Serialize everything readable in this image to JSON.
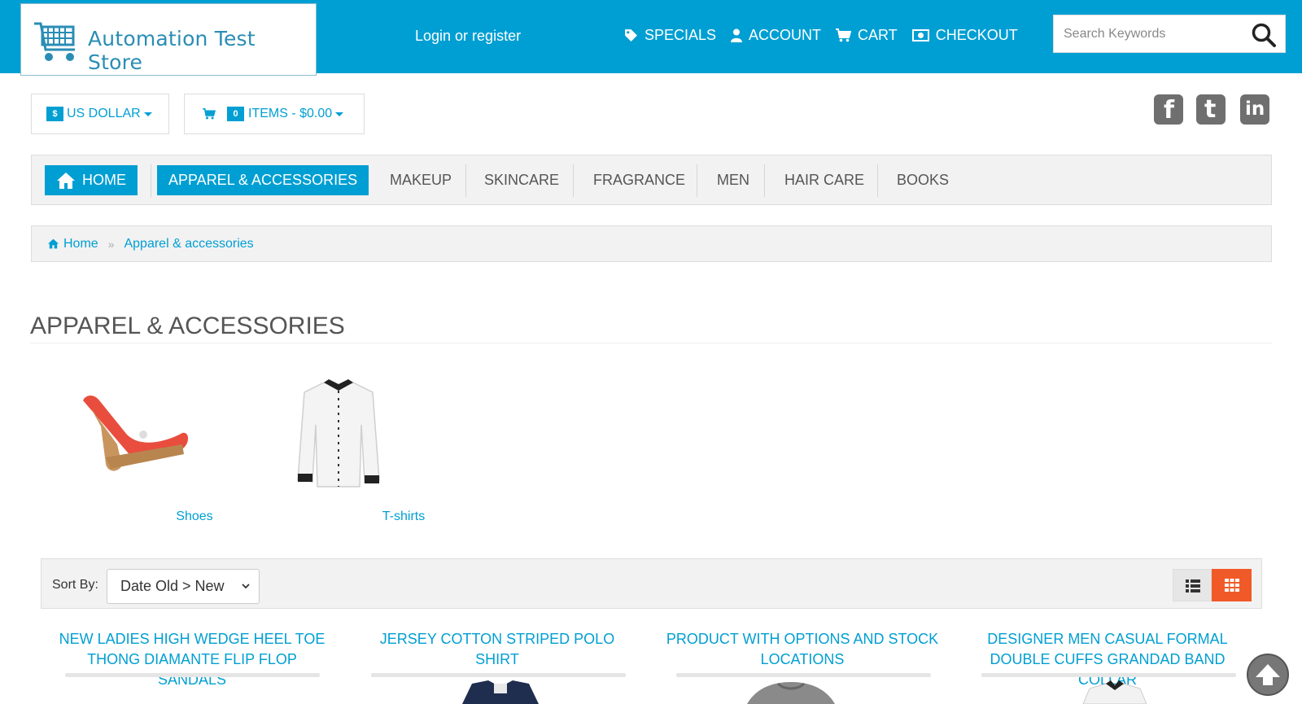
{
  "store": {
    "name": "Automation Test Store"
  },
  "header": {
    "login_label": "Login or register",
    "nav": [
      {
        "label": "SPECIALS",
        "icon": "tag-icon"
      },
      {
        "label": "ACCOUNT",
        "icon": "user-icon"
      },
      {
        "label": "CART",
        "icon": "cart-icon"
      },
      {
        "label": "CHECKOUT",
        "icon": "money-icon"
      }
    ],
    "search": {
      "placeholder": "Search Keywords",
      "icon": "search-icon"
    }
  },
  "currency": {
    "symbol": "$",
    "label": "US DOLLAR"
  },
  "cart_summary": {
    "count": "0",
    "label": "ITEMS - $0.00"
  },
  "social": [
    "facebook-icon",
    "twitter-icon",
    "linkedin-icon"
  ],
  "mainnav": {
    "items": [
      "HOME",
      "APPAREL & ACCESSORIES",
      "MAKEUP",
      "SKINCARE",
      "FRAGRANCE",
      "MEN",
      "HAIR CARE",
      "BOOKS"
    ]
  },
  "breadcrumb": {
    "home": "Home",
    "current": "Apparel & accessories"
  },
  "page": {
    "title": "APPAREL & ACCESSORIES"
  },
  "subcategories": [
    {
      "label": "Shoes"
    },
    {
      "label": "T-shirts"
    }
  ],
  "sort": {
    "label": "Sort By:",
    "selected": "Date Old > New"
  },
  "products": [
    {
      "title": "NEW LADIES HIGH WEDGE HEEL TOE THONG DIAMANTE FLIP FLOP SANDALS"
    },
    {
      "title": "JERSEY COTTON STRIPED POLO SHIRT"
    },
    {
      "title": "PRODUCT WITH OPTIONS AND STOCK LOCATIONS"
    },
    {
      "title": "DESIGNER MEN CASUAL FORMAL DOUBLE CUFFS GRANDAD BAND COLLAR"
    }
  ],
  "colors": {
    "primary": "#009fd3",
    "accent": "#f05a28"
  }
}
